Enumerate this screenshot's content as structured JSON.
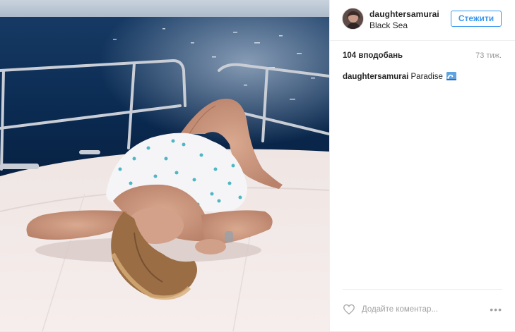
{
  "post": {
    "username": "daughtersamurai",
    "location": "Black Sea",
    "follow_label": "Стежити",
    "likes": "104 вподобань",
    "time": "73 тиж.",
    "caption_user": "daughtersamurai",
    "caption_text": "Paradise",
    "caption_emoji": "wave-emoji",
    "comment_placeholder": "Додайте коментар...",
    "more_label": "•••"
  },
  "colors": {
    "accent": "#3897f0",
    "text": "#262626",
    "muted": "#999999",
    "divider": "#efefef"
  },
  "icons": {
    "heart": "heart-icon",
    "more": "more-options-icon"
  }
}
